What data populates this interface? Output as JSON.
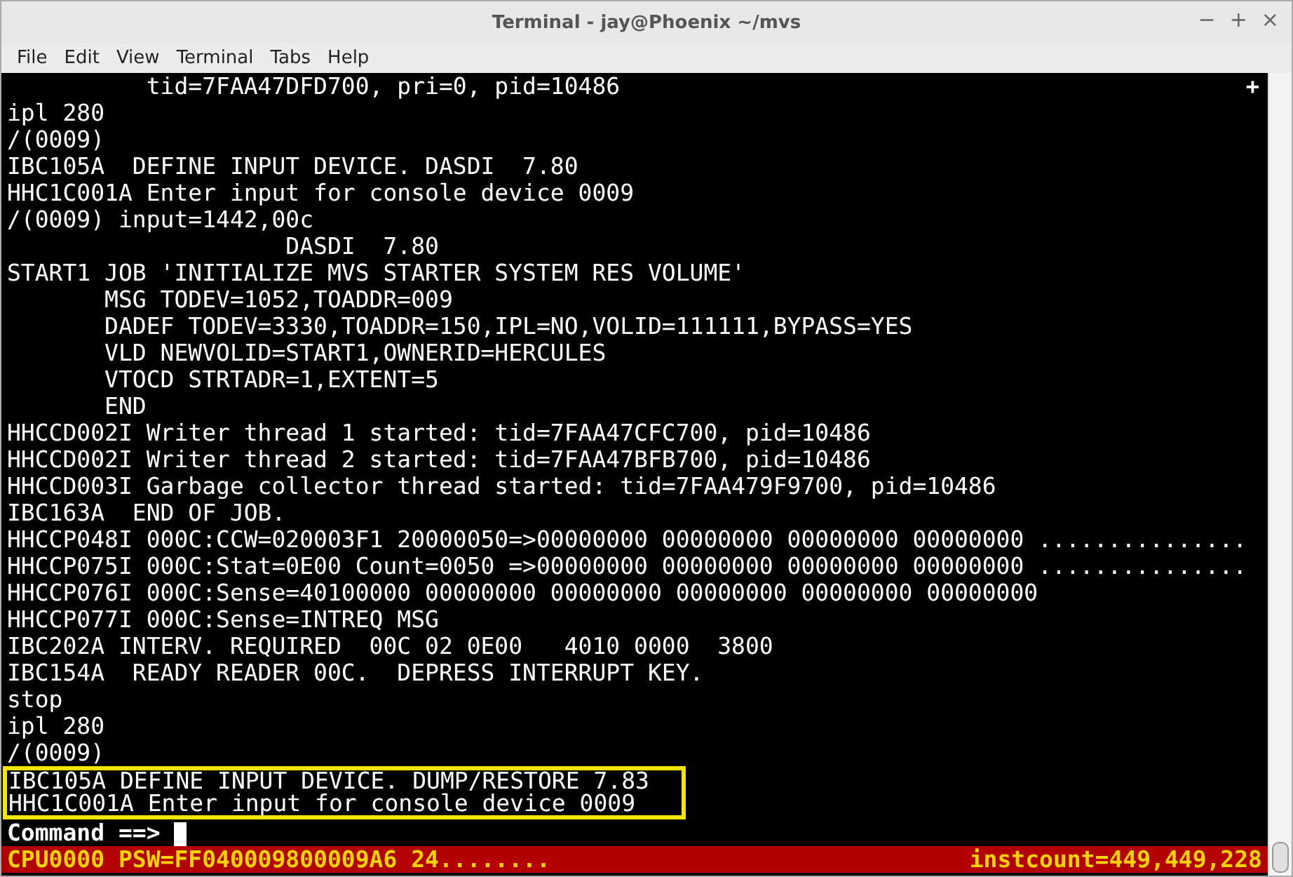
{
  "window": {
    "title": "Terminal - jay@Phoenix ~/mvs",
    "controls": [
      "−",
      "+",
      "×"
    ]
  },
  "menu": [
    "File",
    "Edit",
    "View",
    "Terminal",
    "Tabs",
    "Help"
  ],
  "tab_marker": "+",
  "lines": [
    {
      "text": "          tid=7FAA47DFD700, pri=0, pid=10486",
      "highlighted": false
    },
    {
      "text": "ipl 280",
      "highlighted": false
    },
    {
      "text": "/(0009)",
      "highlighted": false
    },
    {
      "text": "IBC105A  DEFINE INPUT DEVICE. DASDI  7.80",
      "highlighted": false
    },
    {
      "text": "HHC1C001A Enter input for console device 0009",
      "highlighted": false
    },
    {
      "text": "/(0009) input=1442,00c",
      "highlighted": false
    },
    {
      "text": "                    DASDI  7.80",
      "highlighted": false
    },
    {
      "text": "START1 JOB 'INITIALIZE MVS STARTER SYSTEM RES VOLUME'",
      "highlighted": false
    },
    {
      "text": "       MSG TODEV=1052,TOADDR=009",
      "highlighted": false
    },
    {
      "text": "       DADEF TODEV=3330,TOADDR=150,IPL=NO,VOLID=111111,BYPASS=YES",
      "highlighted": false
    },
    {
      "text": "       VLD NEWVOLID=START1,OWNERID=HERCULES",
      "highlighted": false
    },
    {
      "text": "       VTOCD STRTADR=1,EXTENT=5",
      "highlighted": false
    },
    {
      "text": "       END",
      "highlighted": false
    },
    {
      "text": "HHCCD002I Writer thread 1 started: tid=7FAA47CFC700, pid=10486",
      "highlighted": false
    },
    {
      "text": "HHCCD002I Writer thread 2 started: tid=7FAA47BFB700, pid=10486",
      "highlighted": false
    },
    {
      "text": "HHCCD003I Garbage collector thread started: tid=7FAA479F9700, pid=10486",
      "highlighted": false
    },
    {
      "text": "IBC163A  END OF JOB.",
      "highlighted": false
    },
    {
      "text": "HHCCP048I 000C:CCW=020003F1 20000050=>00000000 00000000 00000000 00000000 ...............",
      "highlighted": false
    },
    {
      "text": "HHCCP075I 000C:Stat=0E00 Count=0050 =>00000000 00000000 00000000 00000000 ...............",
      "highlighted": false
    },
    {
      "text": "HHCCP076I 000C:Sense=40100000 00000000 00000000 00000000 00000000 00000000",
      "highlighted": false
    },
    {
      "text": "HHCCP077I 000C:Sense=INTREQ MSG",
      "highlighted": false
    },
    {
      "text": "IBC202A INTERV. REQUIRED  00C 02 0E00   4010 0000  3800",
      "highlighted": false
    },
    {
      "text": "IBC154A  READY READER 00C.  DEPRESS INTERRUPT KEY.",
      "highlighted": false
    },
    {
      "text": "stop",
      "highlighted": false
    },
    {
      "text": "ipl 280",
      "highlighted": false
    },
    {
      "text": "/(0009)",
      "highlighted": false
    },
    {
      "text": "IBC105A DEFINE INPUT DEVICE. DUMP/RESTORE 7.83",
      "highlighted": true
    },
    {
      "text": "HHC1C001A Enter input for console device 0009",
      "highlighted": true
    }
  ],
  "prompt": "Command ==> ",
  "status_bar": {
    "left": "CPU0000 PSW=FF040009800009A6 24........",
    "right": "instcount=449,449,228"
  }
}
